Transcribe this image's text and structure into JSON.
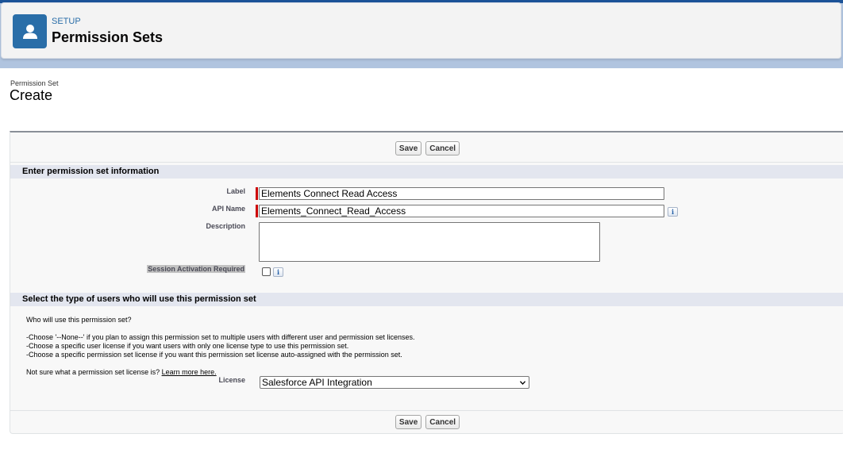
{
  "header": {
    "eyebrow": "SETUP",
    "title": "Permission Sets",
    "icon": "user-icon"
  },
  "page": {
    "breadcrumb_small": "Permission Set",
    "breadcrumb_title": "Create"
  },
  "buttons": {
    "save": "Save",
    "cancel": "Cancel"
  },
  "sections": {
    "info_title": "Enter permission set information",
    "users_title": "Select the type of users who will use this permission set"
  },
  "fields": {
    "label": {
      "label": "Label",
      "value": "Elements Connect Read Access"
    },
    "api_name": {
      "label": "API Name",
      "value": "Elements_Connect_Read_Access"
    },
    "description": {
      "label": "Description",
      "value": ""
    },
    "session": {
      "label": "Session Activation Required",
      "checked": false
    },
    "license": {
      "label": "License",
      "value": "Salesforce API Integration"
    }
  },
  "help": {
    "question": "Who will use this permission set?",
    "line1": "-Choose '--None--' if you plan to assign this permission set to multiple users with different user and permission set licenses.",
    "line2": "-Choose a specific user license if you want users with only one license type to use this permission set.",
    "line3": "-Choose a specific permission set license if you want this permission set license auto-assigned with the permission set.",
    "not_sure": "Not sure what a permission set license is?",
    "learn_more": "Learn more here."
  },
  "colors": {
    "brand": "#2a6ea8",
    "required": "#cc0000",
    "section_bg": "#e3e6ef"
  }
}
